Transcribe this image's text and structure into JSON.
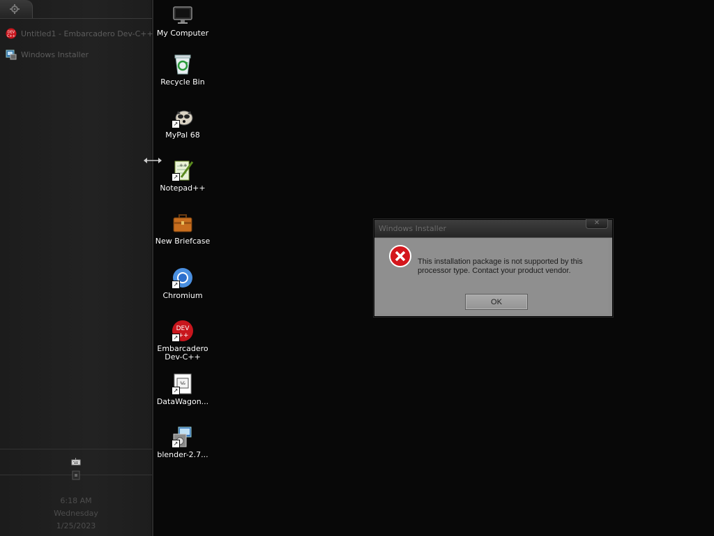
{
  "taskbar": {
    "start_icon": "gear-icon",
    "tasks": [
      {
        "label": "Untitled1 - Embarcadero Dev-C++",
        "icon": "devcpp-icon"
      },
      {
        "label": "Windows Installer",
        "icon": "installer-icon"
      }
    ],
    "tray": {
      "keyboard_icon": "keyboard-icon",
      "volume_icon": "volume-icon"
    },
    "clock": {
      "time": "6:18 AM",
      "day": "Wednesday",
      "date": "1/25/2023"
    }
  },
  "desktop": {
    "icons": [
      {
        "label": "My Computer",
        "icon": "monitor-icon"
      },
      {
        "label": "Recycle Bin",
        "icon": "recycle-bin-icon"
      },
      {
        "label": "MyPal 68",
        "icon": "mypal-icon"
      },
      {
        "label": "Notepad++",
        "icon": "notepadpp-icon"
      },
      {
        "label": "New Briefcase",
        "icon": "briefcase-icon"
      },
      {
        "label": "Chromium",
        "icon": "chromium-icon"
      },
      {
        "label": "Embarcadero Dev-C++",
        "icon": "devcpp-icon"
      },
      {
        "label": "DataWagon...",
        "icon": "datawagon-icon"
      },
      {
        "label": "blender-2.7...",
        "icon": "blender-installer-icon"
      }
    ]
  },
  "dialog": {
    "title": "Windows Installer",
    "close_label": "✕",
    "message": "This installation package is not supported by this processor type. Contact your product vendor.",
    "ok_label": "OK",
    "icon": "error-icon"
  },
  "colors": {
    "desktop_bg": "#080808",
    "taskbar_bg": "#1f1f1f",
    "dialog_bg": "#8f8f8f",
    "error_red": "#d4161c"
  }
}
